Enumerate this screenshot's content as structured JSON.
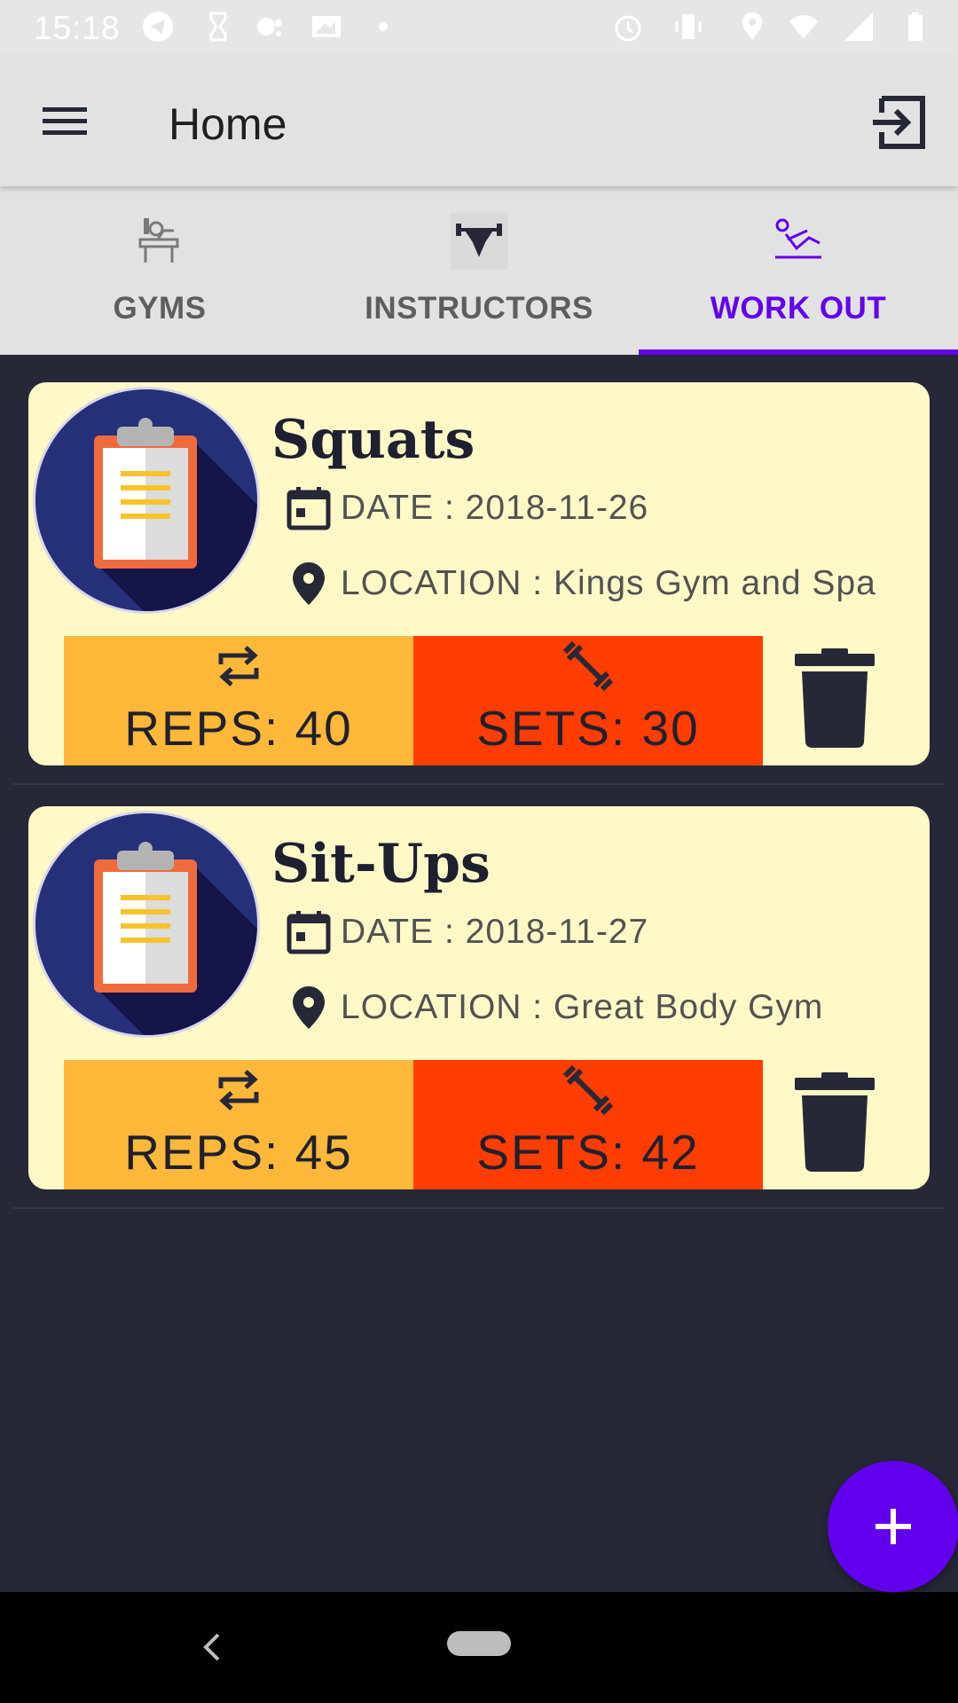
{
  "status_bar": {
    "time": "15:18",
    "left_icons": [
      "telegram-icon",
      "hourglass-icon",
      "assistant-icon",
      "image-icon",
      "dot-icon"
    ],
    "right_icons": [
      "alarm-icon",
      "vibrate-icon",
      "location-icon",
      "wifi-icon",
      "signal-icon",
      "battery-icon"
    ]
  },
  "app_bar": {
    "title": "Home",
    "menu_icon": "menu-icon",
    "action_icon": "logout-icon"
  },
  "tabs": [
    {
      "label": "GYMS",
      "icon": "bench-press-icon",
      "active": false
    },
    {
      "label": "INSTRUCTORS",
      "icon": "weightlifter-icon",
      "active": false
    },
    {
      "label": "WORK OUT",
      "icon": "situp-icon",
      "active": true
    }
  ],
  "workouts": [
    {
      "name": "Squats",
      "date_text": "DATE : 2018-11-26",
      "location_text": "LOCATION : Kings Gym and Spa",
      "reps_text": "REPS: 40",
      "sets_text": "SETS: 30"
    },
    {
      "name": "Sit-Ups",
      "date_text": "DATE : 2018-11-27",
      "location_text": "LOCATION : Great Body Gym",
      "reps_text": "REPS: 45",
      "sets_text": "SETS: 42"
    }
  ],
  "fab": {
    "icon": "add-icon"
  },
  "colors": {
    "accent": "#6200ee",
    "card_bg": "#fff9c8",
    "reps_bg": "#fdb839",
    "sets_bg": "#ff3d00",
    "page_bg": "#262837"
  }
}
